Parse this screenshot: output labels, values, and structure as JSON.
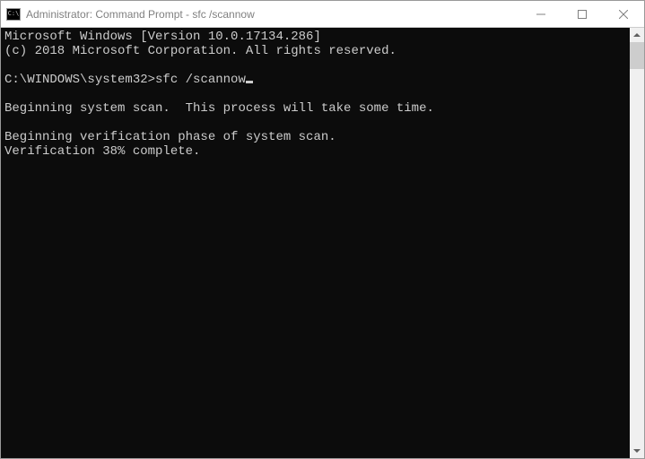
{
  "window": {
    "icon_label": "C:\\",
    "title": "Administrator: Command Prompt - sfc  /scannow"
  },
  "console": {
    "line1": "Microsoft Windows [Version 10.0.17134.286]",
    "line2": "(c) 2018 Microsoft Corporation. All rights reserved.",
    "blank1": "",
    "prompt": "C:\\WINDOWS\\system32>",
    "command": "sfc /scannow",
    "blank2": "",
    "msg1": "Beginning system scan.  This process will take some time.",
    "blank3": "",
    "msg2": "Beginning verification phase of system scan.",
    "msg3": "Verification 38% complete."
  }
}
